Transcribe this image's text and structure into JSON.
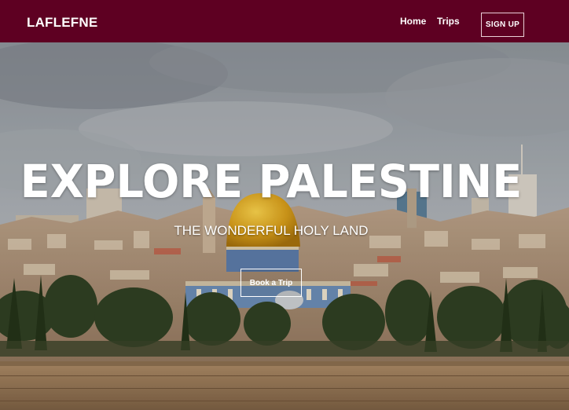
{
  "nav": {
    "brand": "LAFLEFNE",
    "links": [
      {
        "label": "Home"
      },
      {
        "label": "Trips"
      }
    ],
    "signup_label": "SIGN UP"
  },
  "hero": {
    "title": "EXPLORE PALESTINE",
    "subtitle": "THE WONDERFUL HOLY LAND",
    "cta_label": "Book a Trip"
  },
  "colors": {
    "navbar_bg": "#5e0022",
    "text": "#ffffff"
  }
}
